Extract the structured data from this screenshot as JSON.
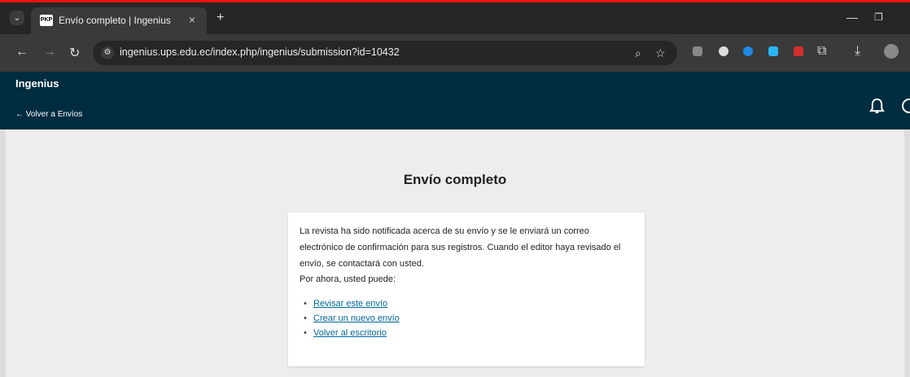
{
  "browser": {
    "tab_title": "Envío completo | Ingenius",
    "favicon_text": "PKP",
    "url": "ingenius.ups.edu.ec/index.php/ingenius/submission?id=10432",
    "icons": [
      "tab-search-icon",
      "back-arrow-icon",
      "forward-arrow-icon",
      "reload-icon",
      "site-info-icon",
      "zoom-icon",
      "bookmark-star-icon",
      "extension-icons",
      "puzzle-icon",
      "download-icon",
      "profile-avatar"
    ]
  },
  "header": {
    "site_title": "Ingenius",
    "back_link": "← Volver a Envíos",
    "background": "#002c40"
  },
  "main": {
    "title": "Envío completo",
    "message": "La revista ha sido notificada acerca de su envío y se le enviará un correo electrónico de confirmación para sus registros. Cuando el editor haya revisado el envío, se contactará con usted.",
    "lead": "Por ahora, usted puede:",
    "actions": [
      {
        "label": "Revisar este envío"
      },
      {
        "label": "Crear un nuevo envío"
      },
      {
        "label": "Volver al escritorio"
      }
    ],
    "link_color": "#006798"
  }
}
